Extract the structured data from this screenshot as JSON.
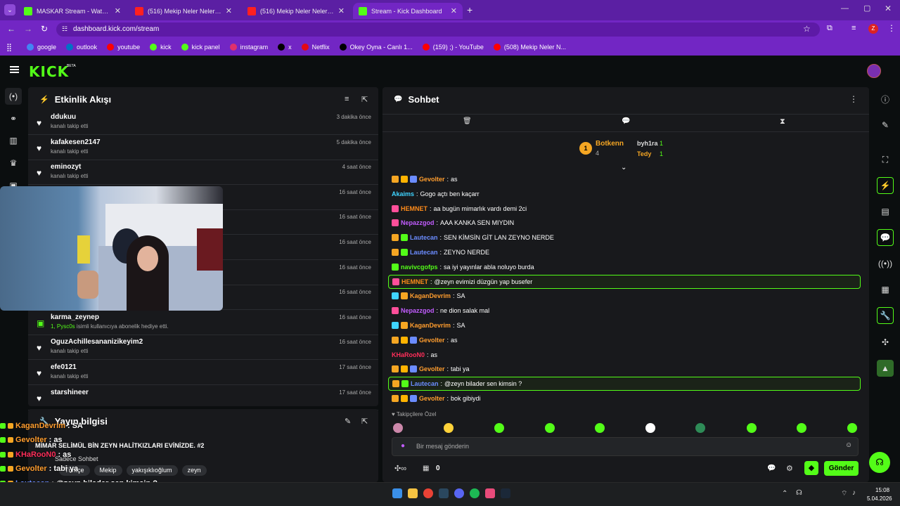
{
  "browser": {
    "tabs": [
      {
        "label": "MASKAR Stream - Watch Live o...",
        "color": "#53fc18"
      },
      {
        "label": "(516) Mekip Neler Neler 59.8ö...",
        "color": "#ff2020"
      },
      {
        "label": "(516) Mekip Neler Neler 60.8ö...",
        "color": "#ff2020"
      },
      {
        "label": "Stream - Kick Dashboard",
        "color": "#53fc18"
      }
    ],
    "url": "dashboard.kick.com/stream",
    "bookmarks": [
      "google",
      "outlook",
      "youtube",
      "kick",
      "kick panel",
      "instagram",
      "x",
      "Netflix",
      "Okey Oyna - Canlı 1...",
      "(159) ;) - YouTube",
      "(508) Mekip Neler N..."
    ]
  },
  "brand": {
    "logo": "KICK",
    "beta": "BETA"
  },
  "activity": {
    "title": "Etkinlik Akışı",
    "items": [
      {
        "name": "ddukuu",
        "sub": "kanalı takip etti",
        "time": "3 dakika önce",
        "type": "follow"
      },
      {
        "name": "kafakesen2147",
        "sub": "kanalı takip etti",
        "time": "5 dakika önce",
        "type": "follow"
      },
      {
        "name": "eminozyt",
        "sub": "kanalı takip etti",
        "time": "4 saat önce",
        "type": "follow"
      },
      {
        "name": "",
        "sub": "",
        "time": "16 saat önce",
        "type": "follow"
      },
      {
        "name": "",
        "sub": "",
        "time": "16 saat önce",
        "type": "follow"
      },
      {
        "name": "",
        "sub": "",
        "time": "16 saat önce",
        "type": "follow"
      },
      {
        "name": "",
        "sub": "",
        "time": "16 saat önce",
        "type": "follow"
      },
      {
        "name": "",
        "sub": "",
        "time": "16 saat önce",
        "type": "follow"
      },
      {
        "name": "karma_zeynep",
        "sub_user": "1, Pysc0s",
        "sub": " isimli kullanıcıya abonelik hediye etti.",
        "time": "16 saat önce",
        "type": "gift"
      },
      {
        "name": "OguzAchillesananizikeyim2",
        "sub": "kanalı takip etti",
        "time": "16 saat önce",
        "type": "follow"
      },
      {
        "name": "efe0121",
        "sub": "kanalı takip etti",
        "time": "17 saat önce",
        "type": "follow"
      },
      {
        "name": "starshineer",
        "sub": "",
        "time": "17 saat önce",
        "type": "follow"
      }
    ]
  },
  "stream_info": {
    "title": "Yayın bilgisi",
    "stream_title": "MİMAR SELİMÜL BİN ZEYN HALİTKIZLARI EVİNİZDE. #2",
    "chat_mode": "Sadece Sohbet",
    "tags": [
      "Türkçe",
      "Mekip",
      "yakışıklıoğlum",
      "zeyn"
    ]
  },
  "chat": {
    "title": "Sohbet",
    "leaderboard": [
      {
        "rank": "1",
        "name": "Botkenn",
        "value": "4"
      },
      {
        "name": "byh1ra",
        "value": "1"
      },
      {
        "name": "Tedy",
        "value": "1"
      }
    ],
    "messages": [
      {
        "user": "Gevolter",
        "color": "#ff9d2e",
        "text": "as",
        "badges": [
          "#f5a623",
          "#ffb300",
          "#6b8cff"
        ]
      },
      {
        "user": "Akaims",
        "color": "#3fd4ff",
        "text": "Gogo açtı ben kaçarr",
        "badges": []
      },
      {
        "user": "HEMNET",
        "color": "#ff8c1a",
        "text": "aa bugün mimarlık vardı demi 2ci",
        "badges": [
          "#ff4f9a"
        ]
      },
      {
        "user": "Nepazzgod",
        "color": "#c25cff",
        "text": "AAA KANKA SEN MIYDIN",
        "badges": [
          "#ff4f9a"
        ]
      },
      {
        "user": "Lautecan",
        "color": "#6b8cff",
        "text": "SEN KİMSİN GİT LAN ZEYNO NERDE",
        "badges": [
          "#f5a623",
          "#53fc18"
        ]
      },
      {
        "user": "Lautecan",
        "color": "#6b8cff",
        "text": "ZEYNO NERDE",
        "badges": [
          "#f5a623",
          "#53fc18"
        ]
      },
      {
        "user": "navivcgofps",
        "color": "#53fc18",
        "text": "sa iyi yayınlar abla noluyo burda",
        "badges": [
          "#53fc18"
        ]
      },
      {
        "user": "HEMNET",
        "color": "#ff8c1a",
        "text": "@zeyn evimizi düzgün yap busefer",
        "badges": [
          "#ff4f9a"
        ],
        "hl": true
      },
      {
        "user": "KaganDevrim",
        "color": "#ff9d2e",
        "text": "SA",
        "badges": [
          "#3fd4ff",
          "#f5a623"
        ]
      },
      {
        "user": "Nepazzgod",
        "color": "#c25cff",
        "text": "ne dion salak mal",
        "badges": [
          "#ff4f9a"
        ]
      },
      {
        "user": "KaganDevrim",
        "color": "#ff9d2e",
        "text": "SA",
        "badges": [
          "#3fd4ff",
          "#f5a623"
        ]
      },
      {
        "user": "Gevolter",
        "color": "#ff9d2e",
        "text": "as",
        "badges": [
          "#f5a623",
          "#ffb300",
          "#6b8cff"
        ]
      },
      {
        "user": "KHaRooN0",
        "color": "#ff2e5a",
        "text": "as",
        "badges": []
      },
      {
        "user": "Gevolter",
        "color": "#ff9d2e",
        "text": "tabi ya",
        "badges": [
          "#f5a623",
          "#ffb300",
          "#6b8cff"
        ]
      },
      {
        "user": "Lautecan",
        "color": "#6b8cff",
        "text": "@zeyn bilader sen kimsin ?",
        "badges": [
          "#f5a623",
          "#53fc18"
        ],
        "hl": true
      },
      {
        "user": "Gevolter",
        "color": "#ff9d2e",
        "text": "bok gibiydi",
        "badges": [
          "#f5a623",
          "#ffb300",
          "#6b8cff"
        ]
      }
    ],
    "emote_label": "Takipçilere Özel",
    "input_placeholder": "Bir mesaj gönderin",
    "points": "0",
    "send": "Gönder"
  },
  "overlay_chat": [
    {
      "user": "KaganDevrim",
      "color": "#ff9d2e",
      "text": "SA"
    },
    {
      "user": "Gevolter",
      "color": "#ff9d2e",
      "text": "as"
    },
    {
      "user": "KHaRooN0",
      "color": "#ff2e5a",
      "text": "as"
    },
    {
      "user": "Gevolter",
      "color": "#ff9d2e",
      "text": "tabi ya"
    },
    {
      "user": "Lautecan",
      "color": "#6b8cff",
      "text": "@zeyn bilader sen kimsin ?"
    },
    {
      "user": "Gevolter",
      "color": "#ff9d2e",
      "text": "bok gibiydi"
    }
  ],
  "taskbar": {
    "time": "15:08",
    "date": "5.04.2026"
  },
  "colors": {
    "accent": "#53fc18",
    "browser": "#7226c4",
    "panel": "#18191c"
  }
}
